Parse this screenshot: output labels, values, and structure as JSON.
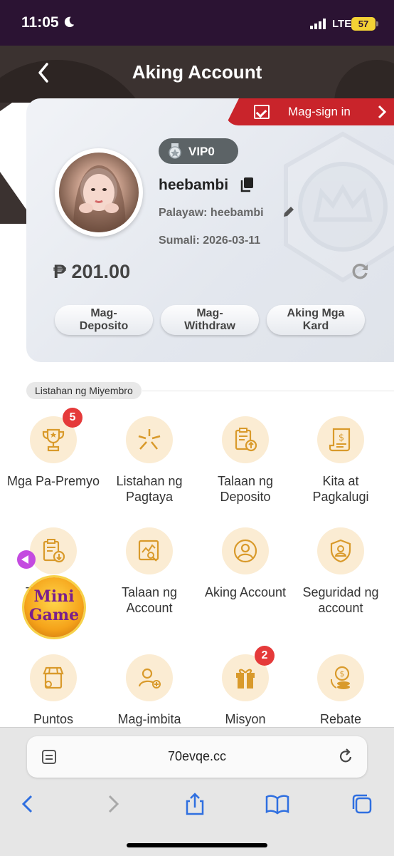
{
  "status": {
    "time": "11:05",
    "network": "LTE",
    "battery": "57"
  },
  "header": {
    "title": "Aking Account"
  },
  "card": {
    "signin_label": "Mag-sign in",
    "vip": "VIP0",
    "username": "heebambi",
    "nickname": "Palayaw: heebambi",
    "joined": "Sumali:  2026-03-11",
    "balance": "₱ 201.00",
    "actions": [
      "Mag-Deposito",
      "Mag-Withdraw",
      "Aking Mga Kard"
    ]
  },
  "member": {
    "section_label": "Listahan ng Miyembro",
    "items": [
      {
        "label": "Mga Pa-Premyo",
        "icon": "trophy-icon",
        "badge": "5"
      },
      {
        "label": "Listahan ng Pagtaya",
        "icon": "betting-list-icon"
      },
      {
        "label": "Talaan ng Deposito",
        "icon": "deposit-record-icon"
      },
      {
        "label": "Kita at Pagkalugi",
        "icon": "profit-loss-icon"
      },
      {
        "label": "Talaan ng Withdraw",
        "icon": "withdraw-record-icon"
      },
      {
        "label": "Talaan ng Account",
        "icon": "account-record-icon"
      },
      {
        "label": "Aking Account",
        "icon": "user-icon"
      },
      {
        "label": "Seguridad ng account",
        "icon": "shield-icon"
      },
      {
        "label": "Puntos",
        "icon": "shop-icon"
      },
      {
        "label": "Mag-imbita",
        "icon": "invite-icon"
      },
      {
        "label": "Misyon",
        "icon": "gift-icon",
        "badge": "2"
      },
      {
        "label": "Rebate",
        "icon": "coins-icon"
      }
    ]
  },
  "minigame": {
    "label": "Mini Game"
  },
  "browser": {
    "url": "70evqe.cc"
  },
  "colors": {
    "accent": "#c9242b",
    "icon_bg": "#fbecd3",
    "icon_stroke": "#d99a2b",
    "header": "#3b3230"
  }
}
